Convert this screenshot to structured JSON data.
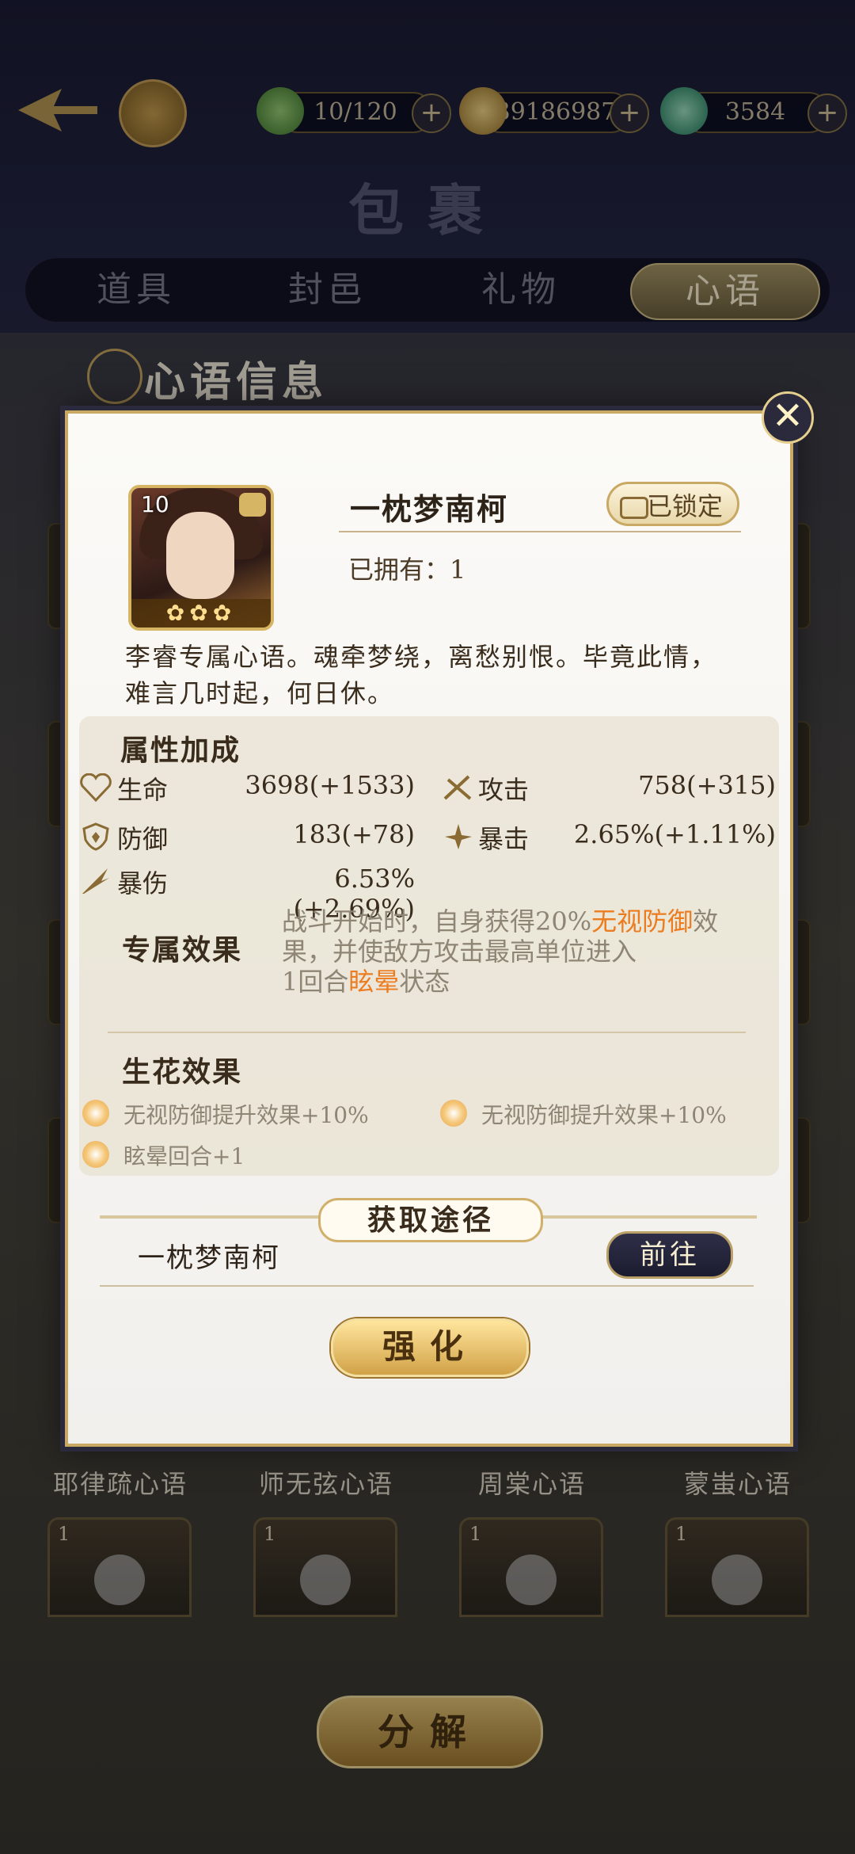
{
  "resources": [
    {
      "icon": "leaf-stamina-icon",
      "value": "10/120"
    },
    {
      "icon": "coin-icon",
      "value": "39186987"
    },
    {
      "icon": "jade-gem-icon",
      "value": "3584"
    }
  ],
  "page_title": "包裹",
  "tabs": [
    "道具",
    "封邑",
    "礼物",
    "心语"
  ],
  "active_tab": "心语",
  "section_title": "心语信息",
  "item": {
    "level": "10",
    "name": "一枕梦南柯",
    "locked_label": "已锁定",
    "owned_label": "已拥有：1",
    "description": "李睿专属心语。魂牵梦绕，离愁别恨。毕竟此情，难言几时起，何日休。"
  },
  "attributes": {
    "heading": "属性加成",
    "items": [
      {
        "icon": "heart-icon",
        "label": "生命",
        "value": "3698(+1533)"
      },
      {
        "icon": "sword-icon",
        "label": "攻击",
        "value": "758(+315)"
      },
      {
        "icon": "shield-icon",
        "label": "防御",
        "value": "183(+78)"
      },
      {
        "icon": "crit-icon",
        "label": "暴击",
        "value": "2.65%(+1.11%)"
      },
      {
        "icon": "crit-damage-icon",
        "label": "暴伤",
        "value": "6.53%(+2.69%)"
      }
    ]
  },
  "exclusive": {
    "heading": "专属效果",
    "text_a": "战斗开始时，自身获得20%",
    "hl_a": "无视防御",
    "text_b": "效果，并使敌方攻击最高单位进入",
    "text_c": "1回合",
    "hl_b": "眩晕",
    "text_d": "状态"
  },
  "bloom": {
    "heading": "生花效果",
    "items": [
      "无视防御提升效果+10%",
      "无视防御提升效果+10%",
      "眩晕回合+1"
    ]
  },
  "source": {
    "heading": "获取途径",
    "name": "一枕梦南柯",
    "button": "前往"
  },
  "enhance_button": "强化",
  "background_grid": {
    "labels": [
      "耶律疏心语",
      "师无弦心语",
      "周棠心语",
      "蒙蚩心语"
    ],
    "card_level": "1"
  },
  "decompose_button": "分解",
  "colors": {
    "highlight": "#ec7c20",
    "gold": "#c9a864"
  }
}
